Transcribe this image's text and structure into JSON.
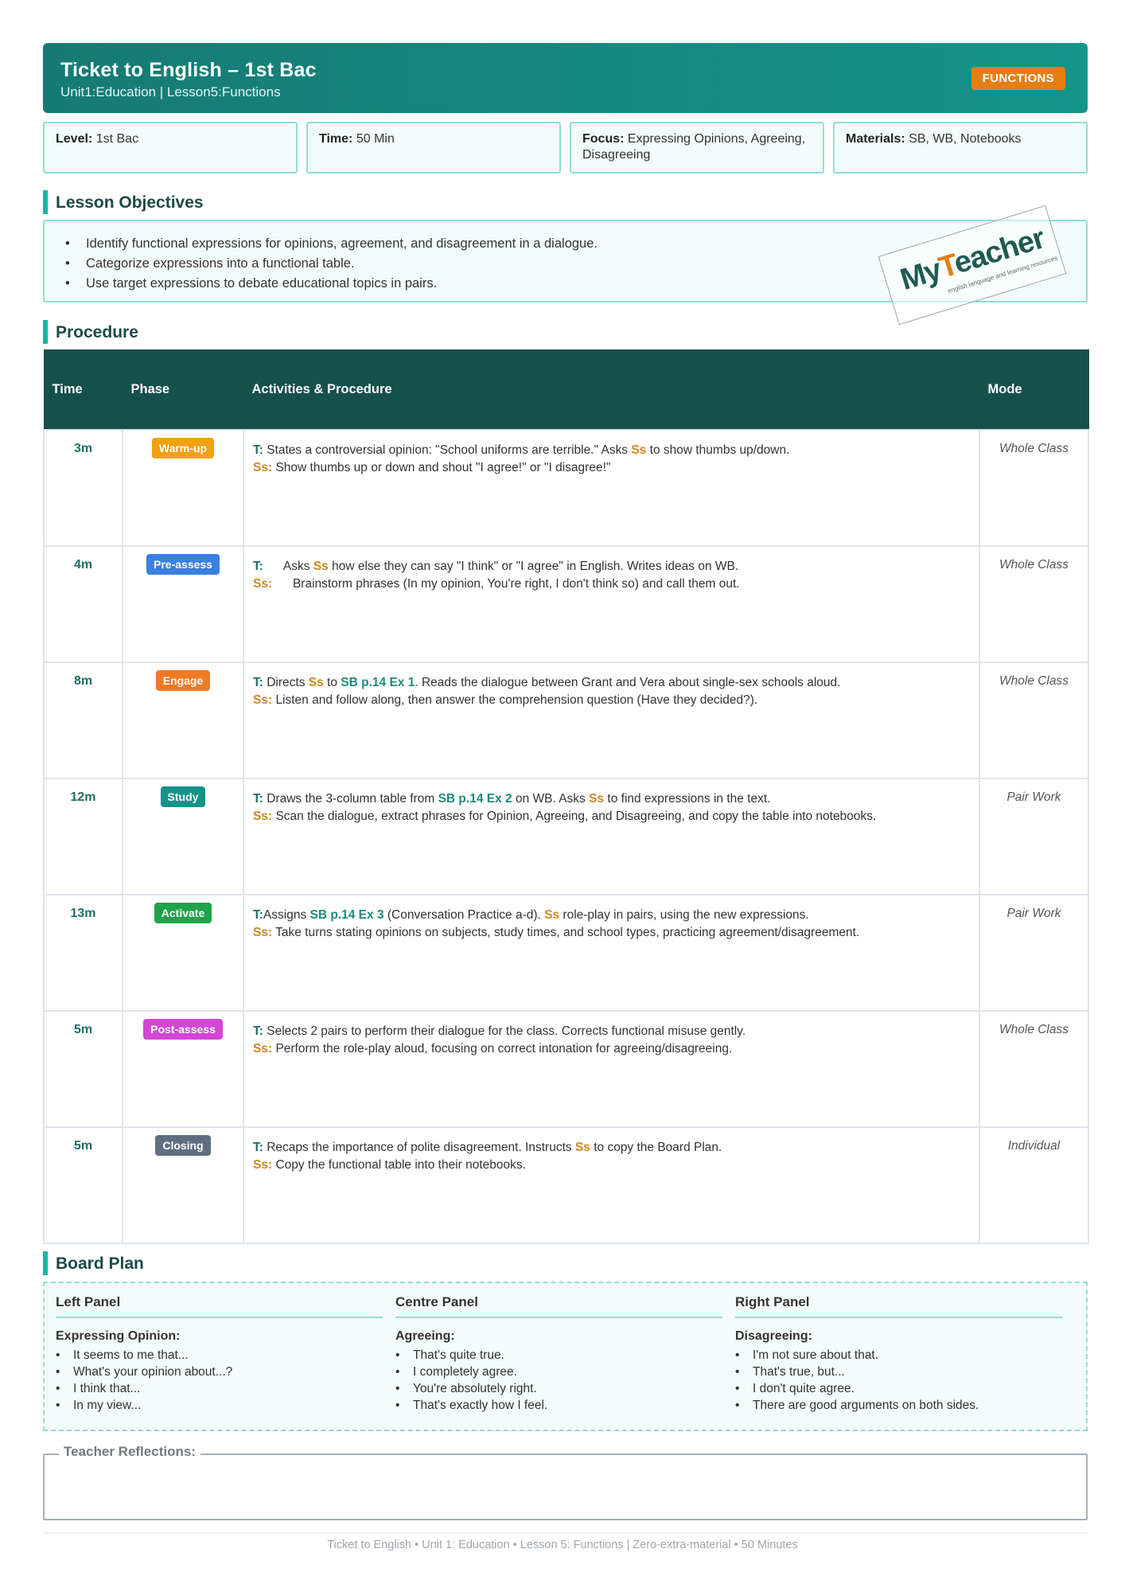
{
  "header": {
    "title": "Ticket to English – 1st Bac",
    "subtitle": "Unit1:Education | Lesson5:Functions",
    "badge": "FUNCTIONS"
  },
  "info": [
    {
      "label": "Level:",
      "value": "1st Bac"
    },
    {
      "label": "Time:",
      "value": "50 Min"
    },
    {
      "label": "Focus:",
      "value": "Expressing Opinions, Agreeing, Disagreeing"
    },
    {
      "label": "Materials:",
      "value": "SB, WB, Notebooks"
    }
  ],
  "objectives": {
    "title": "Lesson Objectives",
    "items": [
      "Identify functional expressions for opinions, agreement, and disagreement in a dialogue.",
      "Categorize expressions into a functional table.",
      "Use target expressions to debate educational topics in pairs."
    ]
  },
  "stamp": {
    "logo": "MyTeacher",
    "tagline": "english language and learning resources"
  },
  "procedure": {
    "title": "Procedure",
    "headers": [
      "Time",
      "Phase",
      "Activities & Procedure",
      "Mode"
    ],
    "t_label": "T:",
    "ss_label": "Ss:",
    "rows": [
      {
        "time": "3m",
        "phase": "Warm-up",
        "color": "#f0a012",
        "mode": "Whole Class",
        "t_pre": "States a controversial opinion: \"School uniforms are terrible.\" Asks ",
        "t_ss": "Ss",
        "t_post": " to show thumbs up/down.",
        "s": "Show thumbs up or down and shout \"I agree!\" or \"I disagree!\""
      },
      {
        "time": "4m",
        "phase": "Pre-assess",
        "color": "#3b7fe0",
        "mode": "Whole Class",
        "t_pre": "Asks ",
        "t_ss": "Ss",
        "t_post": " how else they can say \"I think\" or \"I agree\" in English. Writes ideas on WB.",
        "s": "Brainstorm phrases (In my opinion, You're right, I don't think so) and call them out."
      },
      {
        "time": "8m",
        "phase": "Engage",
        "color": "#ef7a24",
        "mode": "Whole Class",
        "t_pre": "Directs ",
        "t_ss": "Ss",
        "t_mid": " to ",
        "t_ref": "SB p.14 Ex 1",
        "t_post": ". Reads the dialogue between Grant and Vera about single-sex schools aloud.",
        "s": "Listen and follow along, then answer the comprehension question (Have they decided?)."
      },
      {
        "time": "12m",
        "phase": "Study",
        "color": "#17938a",
        "mode": "Pair Work",
        "t_pre": "Draws the 3-column table from ",
        "t_ref": "SB p.14 Ex 2",
        "t_mid": " on WB. Asks ",
        "t_ss": "Ss",
        "t_post": " to find expressions in the text.",
        "s": "Scan the dialogue, extract phrases for Opinion, Agreeing, and Disagreeing, and copy the table into notebooks."
      },
      {
        "time": "13m",
        "phase": "Activate",
        "color": "#1fa34a",
        "mode": "Pair Work",
        "t_pre": "Assigns ",
        "t_ref": "SB p.14 Ex 3",
        "t_mid": " (Conversation Practice a-d). ",
        "t_ss": "Ss",
        "t_post": " role-play in pairs, using the new expressions.",
        "s": "Take turns stating opinions on subjects, study times, and school types, practicing agreement/disagreement."
      },
      {
        "time": "5m",
        "phase": "Post-assess",
        "color": "#d445d8",
        "mode": "Whole Class",
        "t_pre": "Selects 2 pairs to perform their dialogue for the class. Corrects functional misuse gently.",
        "t_ss": "",
        "t_post": "",
        "s": "Perform the role-play aloud, focusing on correct intonation for agreeing/disagreeing."
      },
      {
        "time": "5m",
        "phase": "Closing",
        "color": "#5f6e80",
        "mode": "Individual",
        "t_pre": "Recaps the importance of polite disagreement. Instructs ",
        "t_ss": "Ss",
        "t_post": " to copy the Board Plan.",
        "s": "Copy the functional table into their notebooks."
      }
    ]
  },
  "board": {
    "title": "Board Plan",
    "panels": [
      {
        "title": "Left Panel",
        "sub": "Expressing Opinion:",
        "items": [
          "It seems to me that...",
          "What's your opinion about...?",
          "I think that...",
          "In my view..."
        ]
      },
      {
        "title": "Centre Panel",
        "sub": "Agreeing:",
        "items": [
          "That's quite true.",
          "I completely agree.",
          "You're absolutely right.",
          "That's exactly how I feel."
        ]
      },
      {
        "title": "Right Panel",
        "sub": "Disagreeing:",
        "items": [
          "I'm not sure about that.",
          "That's true, but...",
          "I don't quite agree.",
          "There are good arguments on both sides."
        ]
      }
    ]
  },
  "reflections": {
    "label": "Teacher Reflections:"
  },
  "footer": "Ticket to English • Unit 1: Education • Lesson 5: Functions | Zero-extra-material • 50 Minutes"
}
